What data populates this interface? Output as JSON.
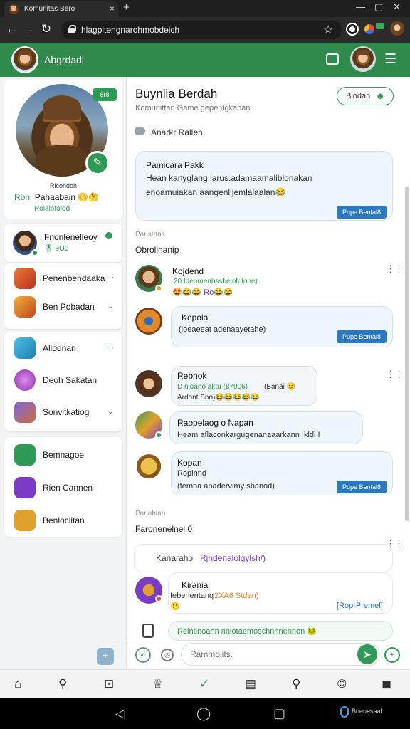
{
  "browser": {
    "tab_title": "Komunitas Bero",
    "tab_close": "×",
    "new_tab": "+",
    "window_minimize": "—",
    "window_restore": "▢",
    "window_close": "✕",
    "url": "hlagpitengnarohmobdeich",
    "back": "←",
    "forward": "→",
    "reload": "↻",
    "star": "☆"
  },
  "header": {
    "title": "Abgrdadi",
    "inbox_icon": "⊡",
    "menu_icon": "☰"
  },
  "profile": {
    "level_badge": "8r8",
    "handle": "Ricohdoh",
    "name_prefix": "Rbn",
    "name": "Pahaabain",
    "name_emoji": "😊🤔",
    "stat": "Rolalofolod",
    "edit_icon": "✎"
  },
  "sidebar": {
    "friend": {
      "name": "Fnonlenelleoy",
      "status": "🎖 9O3"
    },
    "group_a": [
      {
        "label": "Penenbendaaka",
        "chevron": "⋯",
        "color": "#d9482b"
      },
      {
        "label": "Ben Pobadan",
        "chevron": "⌄",
        "color": "#e08a2a"
      }
    ],
    "group_b": [
      {
        "label": "Aliodnan",
        "chevron": "⋯",
        "color": "#2aa1c9"
      },
      {
        "label": "Deoh Sakatan",
        "chevron": "",
        "color": "#a347c6"
      },
      {
        "label": "Sonvitkatiog",
        "chevron": "⌄",
        "color": "#6b58c9"
      }
    ],
    "group_c": [
      {
        "label": "Bemnagoe",
        "color": "#2f9a56"
      },
      {
        "label": "Rien Cannen",
        "color": "#7a3cc4"
      },
      {
        "label": "Benloclitan",
        "color": "#e0a12a"
      }
    ],
    "fab_icon": "±"
  },
  "group": {
    "title": "Buynlia Berdah",
    "subtitle": "Komunittan Game gepentgkahan",
    "join_label": "Biodan",
    "join_icon": "♣",
    "announce_label": "Anarkr Rallen"
  },
  "pinned": {
    "title": "Pamicara Pakk",
    "line1": "Hean kanyglang larus.adamaamaliblonakan",
    "line2": "enoamuiakan aangenlljemlalaalan😂",
    "pill": "Pupe Bental8"
  },
  "section1": {
    "label": "Panstaas",
    "title": "Obrolihanip"
  },
  "messages": [
    {
      "name": "Kojdend",
      "text": "20 Idenmenbssbelnfdlone)",
      "reacts": "🤩😂😂 Ro😂😂"
    },
    {
      "name": "Kepola",
      "text": "(loeaeeat adenaayetahe)",
      "pill": "Pupe Bental8"
    },
    {
      "name": "Rebnok",
      "meta": "D nioano aktu (87906)",
      "text_tail": "(Banai 😊",
      "text2": "Ardont Sno)😂😂😂😂😂"
    },
    {
      "name": "Raopelaog o Napan",
      "text": "Heam aflaconkargugenanaaarkann Ikldi I"
    },
    {
      "name": "Kopan",
      "text": "Ropinnd",
      "text2": "(femna anadervimy sbanod)",
      "pill": "Pupe Bental8"
    }
  ],
  "section2": {
    "label": "Panabian",
    "title": "Faronenelnel 0"
  },
  "thread": {
    "head_label": "Kanaraho",
    "head_link": "Rjhdenalolgylsh/)",
    "name": "Kirania",
    "text": "Iebenentanq",
    "meta": "2XA6 Stdan)",
    "emoji": "😕",
    "link": "[Rop-Premel]"
  },
  "preview_text": "Reintinoann nnlotaemoschnnnennon 🐸",
  "composer": {
    "placeholder": "Rammolits.",
    "send_icon": "➤",
    "check_icon": "✓",
    "emoji_icon": "◎",
    "add_icon": "+"
  },
  "bottom_nav": [
    "⌂",
    "⚲",
    "⊡",
    "♕",
    "✓",
    "▤",
    "⚲",
    "©",
    "◼"
  ],
  "system": {
    "back": "◁",
    "home": "◯",
    "recents": "▢",
    "corner_text": "Boenesaal"
  }
}
